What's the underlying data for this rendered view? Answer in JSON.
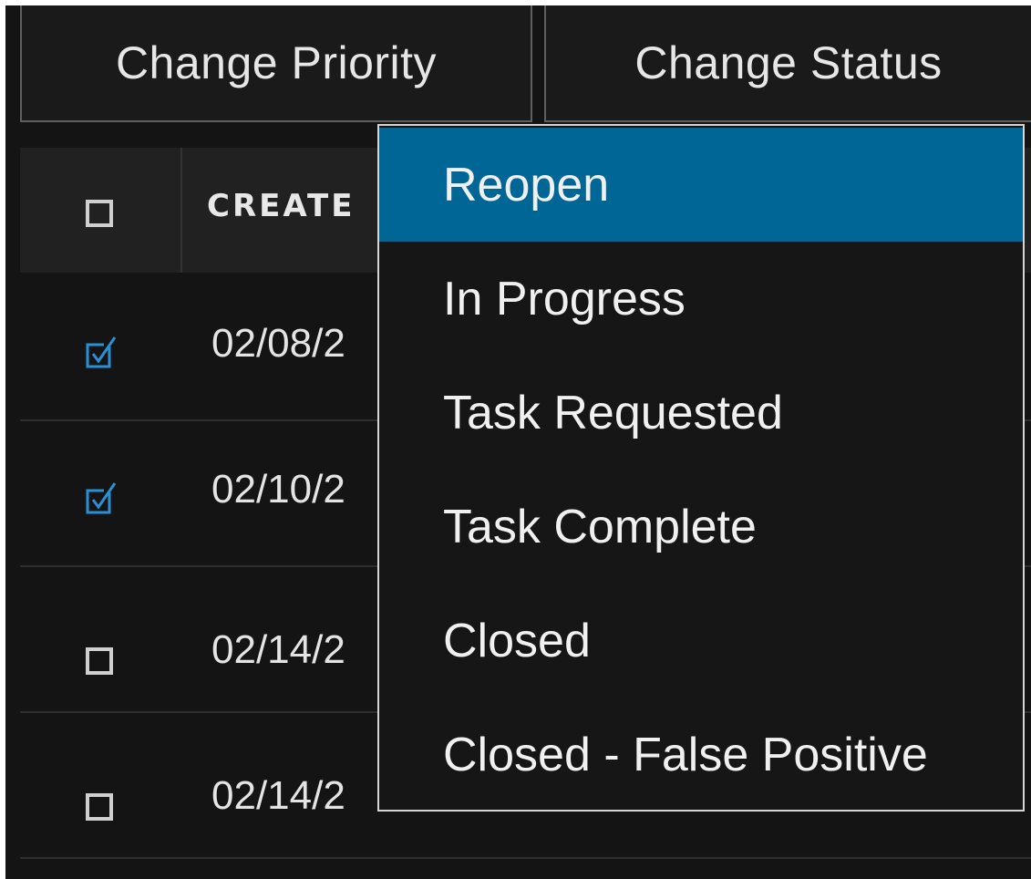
{
  "toolbar": {
    "change_priority_label": "Change Priority",
    "change_status_label": "Change Status"
  },
  "table": {
    "header": {
      "select_all_checked": false,
      "created_column_label": "CREATE"
    },
    "rows": [
      {
        "checked": true,
        "created": "02/08/2"
      },
      {
        "checked": true,
        "created": "02/10/2"
      },
      {
        "checked": false,
        "created": "02/14/2"
      },
      {
        "checked": false,
        "created": "02/14/2"
      }
    ]
  },
  "status_menu": {
    "highlighted_index": 0,
    "items": [
      {
        "label": "Reopen"
      },
      {
        "label": "In Progress"
      },
      {
        "label": "Task Requested"
      },
      {
        "label": "Task Complete"
      },
      {
        "label": "Closed"
      },
      {
        "label": "Closed - False Positive"
      }
    ]
  },
  "colors": {
    "background": "#141414",
    "header_background": "#212121",
    "accent_checkbox": "#2b8fd6",
    "menu_highlight": "#006696",
    "menu_border": "#d6d6d6",
    "text": "#e6e6e6"
  },
  "icons": {
    "checkbox_checked": "checkbox-checked-icon",
    "checkbox_unchecked": "checkbox-unchecked-icon"
  }
}
